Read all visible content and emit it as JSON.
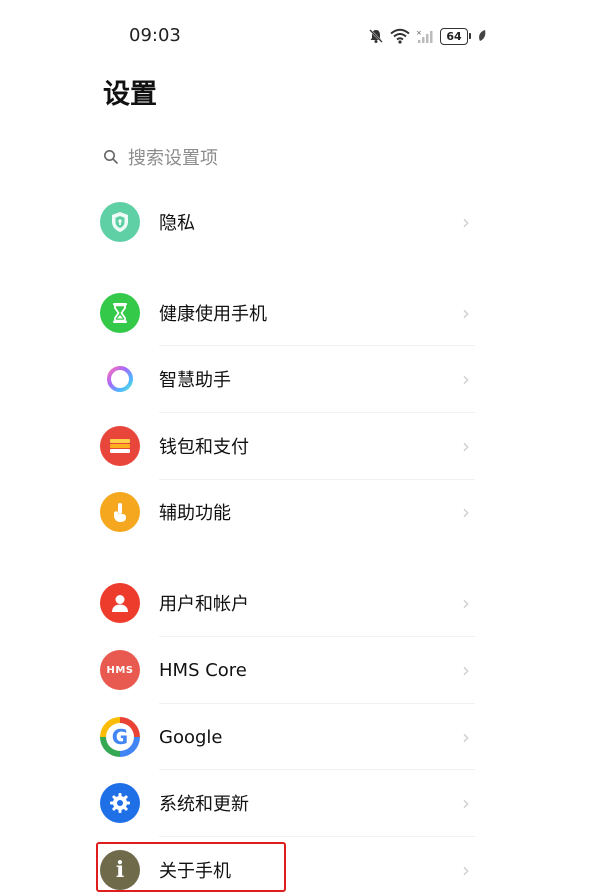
{
  "status": {
    "time": "09:03",
    "battery": "64"
  },
  "title": "设置",
  "search": {
    "placeholder": "搜索设置项"
  },
  "items": [
    {
      "label": "隐私",
      "icon": "shield-icon"
    },
    {
      "label": "健康使用手机",
      "icon": "hourglass-icon"
    },
    {
      "label": "智慧助手",
      "icon": "ring-icon"
    },
    {
      "label": "钱包和支付",
      "icon": "wallet-icon"
    },
    {
      "label": "辅助功能",
      "icon": "hand-icon"
    },
    {
      "label": "用户和帐户",
      "icon": "user-icon"
    },
    {
      "label": "HMS Core",
      "icon": "hms-icon",
      "icon_text": "HMS"
    },
    {
      "label": "Google",
      "icon": "google-icon",
      "icon_text": "G"
    },
    {
      "label": "系统和更新",
      "icon": "gear-icon"
    },
    {
      "label": "关于手机",
      "icon": "info-icon",
      "icon_text": "i"
    }
  ],
  "colors": {
    "privacy": "#5fd0a6",
    "health": "#35c94a",
    "wallet": "#e8463b",
    "accessibility": "#f5a81f",
    "user": "#ee3c2c",
    "hms": "#e85a4f",
    "system": "#1f6fe6",
    "about": "#6e6a4a",
    "highlight": "#e01d1d"
  }
}
